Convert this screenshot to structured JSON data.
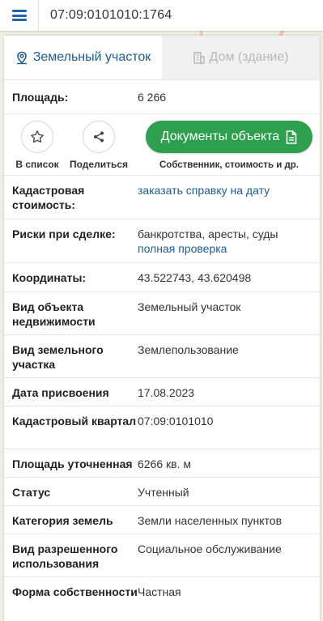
{
  "topbar": {
    "search_value": "07:09:0101010:1764"
  },
  "tabs": [
    {
      "label": "Земельный участок",
      "icon": "map-pin-icon",
      "active": true
    },
    {
      "label": "Дом (здание)",
      "icon": "building-icon",
      "active": false
    }
  ],
  "area": {
    "label": "Площадь:",
    "value": "6 266"
  },
  "actions": {
    "to_list_label": "В список",
    "share_label": "Поделиться",
    "documents_label": "Документы объекта",
    "documents_sub": "Собственник, стоимость и др."
  },
  "rows": {
    "cadastral_cost": {
      "label": "Кадастровая стоимость:",
      "value": "заказать справку на дату"
    },
    "risks": {
      "label": "Риски при сделке:",
      "value": "банкротства, аресты, суды",
      "link": "полная проверка"
    },
    "coords": {
      "label": "Координаты:",
      "value": "43.522743, 43.620498"
    },
    "object_type": {
      "label": "Вид объекта недвижимости",
      "value": "Земельный участок"
    },
    "land_type": {
      "label": "Вид земельного участка",
      "value": "Землепользование"
    },
    "assign_date": {
      "label": "Дата присвоения",
      "value": "17.08.2023"
    },
    "quarter": {
      "label": "Кадастровый квартал",
      "value": "07:09:0101010"
    },
    "area_precise": {
      "label": "Площадь уточненная",
      "value": "6266 кв. м"
    },
    "status": {
      "label": "Статус",
      "value": "Учтенный"
    },
    "category": {
      "label": "Категория земель",
      "value": "Земли населенных пунктов"
    },
    "permitted_use": {
      "label": "Вид разрешенного использования",
      "value": "Социальное обслуживание"
    },
    "ownership": {
      "label": "Форма собственности",
      "value": "Частная"
    }
  },
  "colors": {
    "accent_blue": "#1f5d8c",
    "menu_blue": "#1f66a8",
    "green_button": "#2e9e4f"
  }
}
